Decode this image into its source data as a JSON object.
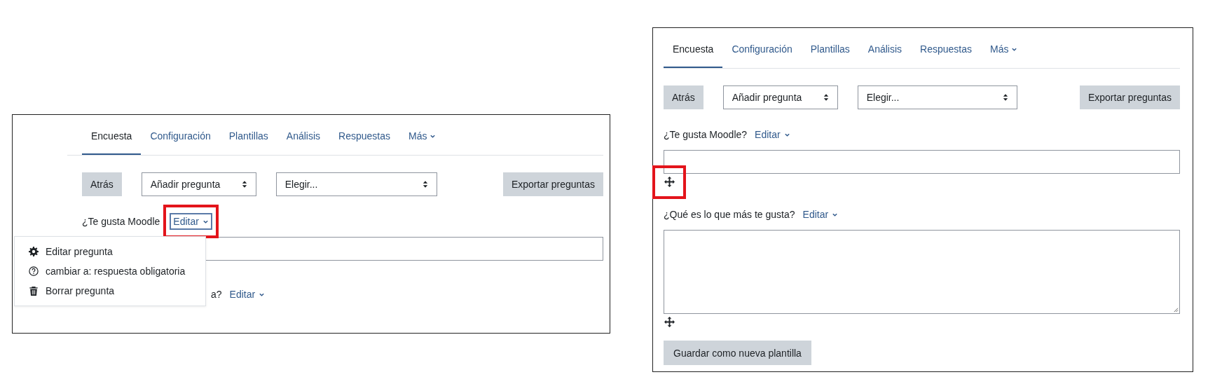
{
  "panels": [
    {
      "tabs": [
        {
          "label": "Encuesta",
          "selected": true,
          "dropdown": false
        },
        {
          "label": "Configuración",
          "selected": false,
          "dropdown": false
        },
        {
          "label": "Plantillas",
          "selected": false,
          "dropdown": false
        },
        {
          "label": "Análisis",
          "selected": false,
          "dropdown": false
        },
        {
          "label": "Respuestas",
          "selected": false,
          "dropdown": false
        },
        {
          "label": "Más",
          "selected": false,
          "dropdown": true
        }
      ],
      "back_button": "Atrás",
      "add_select": "Añadir pregunta",
      "choose_select": "Elegir...",
      "export_button": "Exportar preguntas",
      "questions": [
        {
          "label": "¿Te gusta Moodle",
          "edit": "Editar",
          "edit_highlighted": true,
          "covered": false,
          "kind": "text",
          "move_icon": false
        },
        {
          "label": "a?",
          "edit": "Editar",
          "edit_highlighted": false,
          "covered": true,
          "kind": "label_only",
          "move_icon": false
        }
      ],
      "menu": [
        {
          "kind": "gear",
          "label": "Editar pregunta"
        },
        {
          "kind": "help",
          "label": "cambiar a: respuesta obligatoria"
        },
        {
          "kind": "trash",
          "label": "Borrar pregunta"
        }
      ]
    },
    {
      "tabs": [
        {
          "label": "Encuesta",
          "selected": true,
          "dropdown": false
        },
        {
          "label": "Configuración",
          "selected": false,
          "dropdown": false
        },
        {
          "label": "Plantillas",
          "selected": false,
          "dropdown": false
        },
        {
          "label": "Análisis",
          "selected": false,
          "dropdown": false
        },
        {
          "label": "Respuestas",
          "selected": false,
          "dropdown": false
        },
        {
          "label": "Más",
          "selected": false,
          "dropdown": true
        }
      ],
      "back_button": "Atrás",
      "add_select": "Añadir pregunta",
      "choose_select": "Elegir...",
      "export_button": "Exportar preguntas",
      "questions": [
        {
          "label": "¿Te gusta Moodle?",
          "edit": "Editar",
          "edit_highlighted": false,
          "covered": false,
          "kind": "text",
          "move_icon": true,
          "move_highlighted": true
        },
        {
          "label": "¿Qué es lo que más te gusta?",
          "edit": "Editar",
          "edit_highlighted": false,
          "covered": false,
          "kind": "textarea",
          "move_icon": true,
          "move_highlighted": false
        }
      ],
      "save_template_button": "Guardar como nueva plantilla"
    }
  ]
}
